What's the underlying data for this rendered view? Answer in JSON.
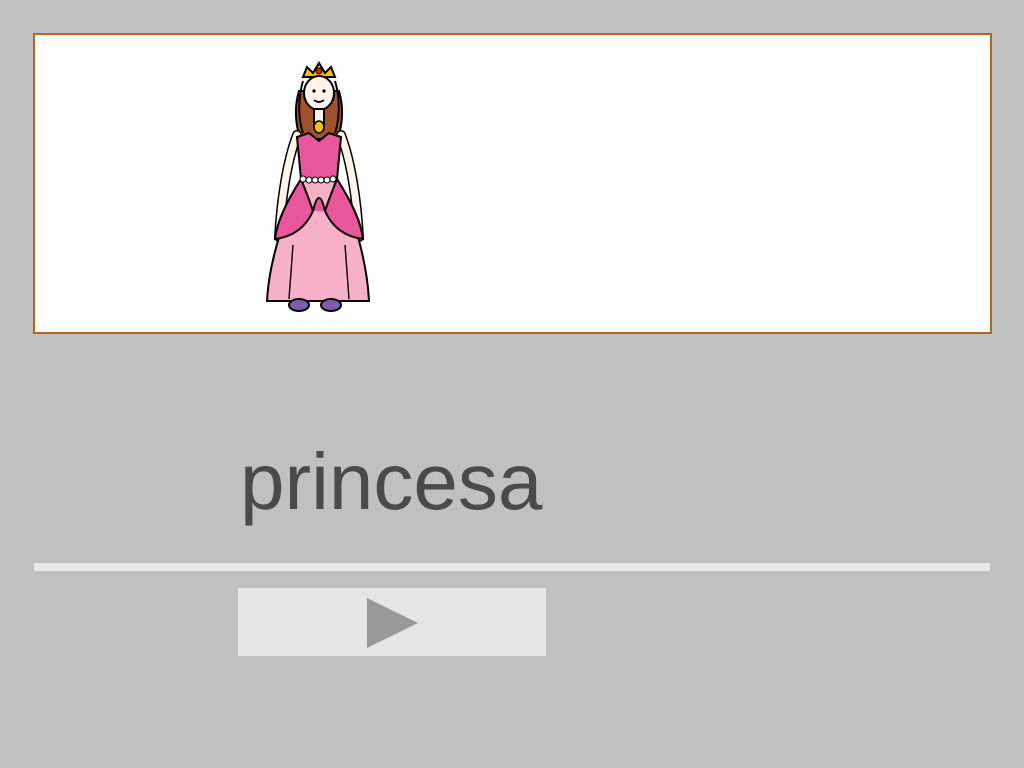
{
  "picture": {
    "icon": "princess-pictogram"
  },
  "word": {
    "text": "princesa"
  },
  "controls": {
    "play_icon": "play-triangle-icon"
  },
  "colors": {
    "background": "#c0c0c0",
    "card_border": "#b5651d",
    "word_text": "#4a4a4a",
    "divider": "#e8e8e8",
    "button_bg": "#e6e6e6",
    "play_icon": "#999999"
  }
}
